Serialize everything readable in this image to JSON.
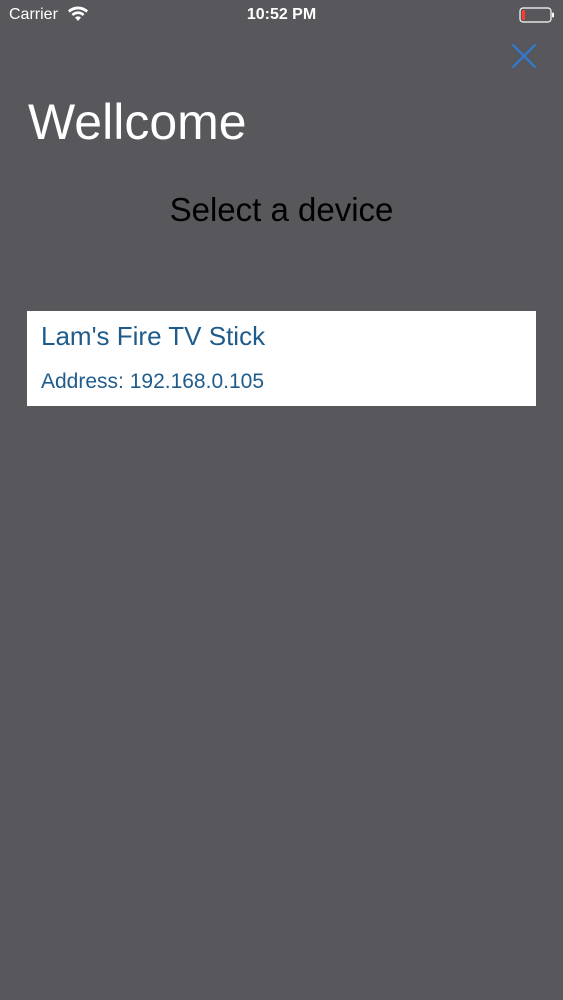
{
  "status_bar": {
    "carrier": "Carrier",
    "time": "10:52 PM",
    "wifi_icon": "wifi-icon",
    "battery_icon": "battery-icon",
    "battery_level_color": "#ff3b30"
  },
  "header": {
    "title": "Wellcome",
    "close_icon": "close-icon",
    "close_color": "#2f7bd9"
  },
  "main": {
    "subtitle": "Select a device",
    "devices": [
      {
        "name": "Lam's Fire TV Stick",
        "address": "Address: 192.168.0.105"
      }
    ]
  },
  "colors": {
    "background": "#58575b",
    "device_text": "#1f5c8c",
    "card_background": "#ffffff"
  }
}
